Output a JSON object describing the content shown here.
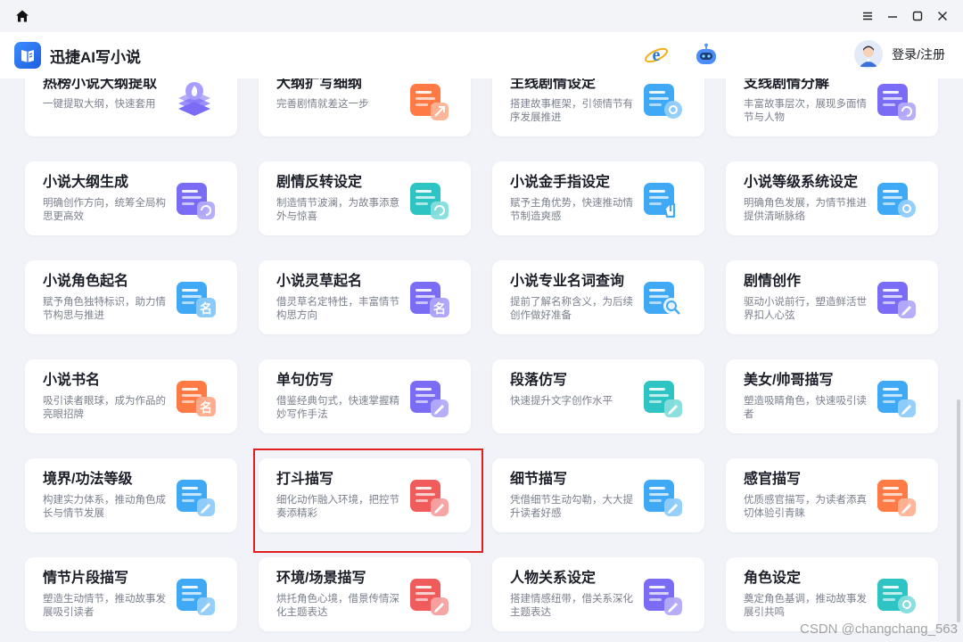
{
  "app": {
    "title": "迅捷AI写小说",
    "login_label": "登录/注册"
  },
  "window": {
    "min": "minimize",
    "max": "maximize",
    "close": "close"
  },
  "cards": [
    {
      "title": "热榜小说大纲提取",
      "desc": "一键提取大纲，快速套用",
      "icon": "layers-fire-icon",
      "color": "#7b6cf6"
    },
    {
      "title": "大纲扩写细纲",
      "desc": "完善剧情就差这一步",
      "icon": "list-expand-icon",
      "color": "#ff7a45"
    },
    {
      "title": "主线剧情设定",
      "desc": "搭建故事框架，引领情节有序发展推进",
      "icon": "doc-gear-icon",
      "color": "#3fa9f5"
    },
    {
      "title": "支线剧情分解",
      "desc": "丰富故事层次，展现多面情节与人物",
      "icon": "doc-branch-icon",
      "color": "#7b6cf6"
    },
    {
      "title": "小说大纲生成",
      "desc": "明确创作方向，统筹全局构思更高效",
      "icon": "doc-refresh-icon",
      "color": "#7b6cf6"
    },
    {
      "title": "剧情反转设定",
      "desc": "制造情节波澜，为故事添意外与惊喜",
      "icon": "list-turn-icon",
      "color": "#2ec4c4"
    },
    {
      "title": "小说金手指设定",
      "desc": "赋予主角优势，快速推动情节制造爽感",
      "icon": "map-finger-icon",
      "color": "#3fa9f5"
    },
    {
      "title": "小说等级系统设定",
      "desc": "明确角色发展，为情节推进提供清晰脉络",
      "icon": "star-gear-icon",
      "color": "#3fa9f5"
    },
    {
      "title": "小说角色起名",
      "desc": "赋予角色独特标识，助力情节构思与推进",
      "icon": "mask-name-icon",
      "color": "#3fa9f5"
    },
    {
      "title": "小说灵草起名",
      "desc": "借灵草名定特性，丰富情节构思方向",
      "icon": "leaf-name-icon",
      "color": "#7b6cf6"
    },
    {
      "title": "小说专业名词查询",
      "desc": "提前了解名称含义，为后续创作做好准备",
      "icon": "book-search-icon",
      "color": "#3fa9f5"
    },
    {
      "title": "剧情创作",
      "desc": "驱动小说前行，塑造鲜活世界扣人心弦",
      "icon": "doc-pen-icon",
      "color": "#7b6cf6"
    },
    {
      "title": "小说书名",
      "desc": "吸引读者眼球，成为作品的亮眼招牌",
      "icon": "book-name-icon",
      "color": "#ff7a45"
    },
    {
      "title": "单句仿写",
      "desc": "借鉴经典句式，快速掌握精妙写作手法",
      "icon": "doc-edit-icon",
      "color": "#7b6cf6"
    },
    {
      "title": "段落仿写",
      "desc": "快速提升文字创作水平",
      "icon": "paragraph-edit-icon",
      "color": "#2ec4c4"
    },
    {
      "title": "美女/帅哥描写",
      "desc": "塑造吸睛角色，快速吸引读者",
      "icon": "face-edit-icon",
      "color": "#3fa9f5"
    },
    {
      "title": "境界/功法等级",
      "desc": "构建实力体系，推动角色成长与情节发展",
      "icon": "person-chart-icon",
      "color": "#3fa9f5"
    },
    {
      "title": "打斗描写",
      "desc": "细化动作融入环境，把控节奏添精彩",
      "icon": "fist-edit-icon",
      "color": "#f05c5c"
    },
    {
      "title": "细节描写",
      "desc": "凭借细节生动勾勒，大大提升读者好感",
      "icon": "atom-edit-icon",
      "color": "#3fa9f5"
    },
    {
      "title": "感官描写",
      "desc": "优质感官描写，为读者添真切体验引青睐",
      "icon": "lips-edit-icon",
      "color": "#ff7a45"
    },
    {
      "title": "情节片段描写",
      "desc": "塑造生动情节，推动故事发展吸引读者",
      "icon": "play-edit-icon",
      "color": "#3fa9f5"
    },
    {
      "title": "环境/场景描写",
      "desc": "烘托角色心境，借景传情深化主题表达",
      "icon": "leaf-edit-icon",
      "color": "#f05c5c"
    },
    {
      "title": "人物关系设定",
      "desc": "搭建情感纽带，借关系深化主题表达",
      "icon": "relation-edit-icon",
      "color": "#7b6cf6"
    },
    {
      "title": "角色设定",
      "desc": "奠定角色基调，推动故事发展引共鸣",
      "icon": "mask-gear-icon",
      "color": "#2ec4c4"
    }
  ],
  "watermark": "CSDN @changchang_563"
}
